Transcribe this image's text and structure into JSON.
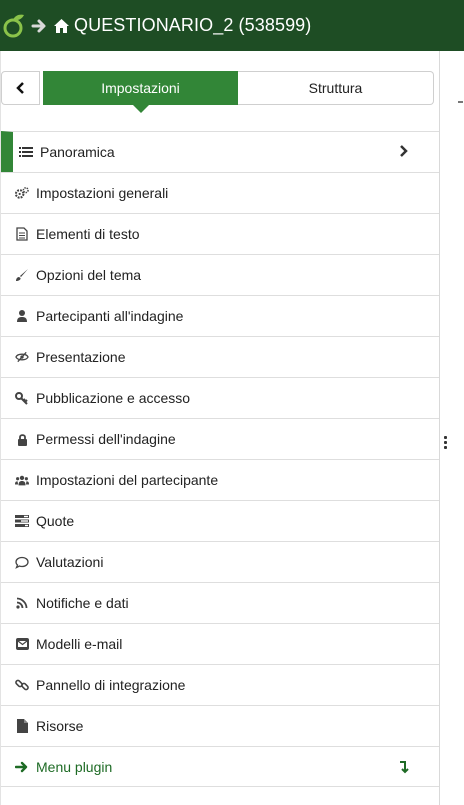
{
  "header": {
    "survey_title": "QUESTIONARIO_2 (538599)"
  },
  "tabs": {
    "settings_label": "Impostazioni",
    "structure_label": "Struttura"
  },
  "menu": {
    "items": [
      {
        "label": "Panoramica",
        "icon": "list-icon"
      },
      {
        "label": "Impostazioni generali",
        "icon": "cogs-icon"
      },
      {
        "label": "Elementi di testo",
        "icon": "document-icon"
      },
      {
        "label": "Opzioni del tema",
        "icon": "paintbrush-icon"
      },
      {
        "label": "Partecipanti all'indagine",
        "icon": "user-icon"
      },
      {
        "label": "Presentazione",
        "icon": "eye-slash-icon"
      },
      {
        "label": "Pubblicazione e accesso",
        "icon": "key-icon"
      },
      {
        "label": "Permessi dell'indagine",
        "icon": "lock-icon"
      },
      {
        "label": "Impostazioni del partecipante",
        "icon": "users-icon"
      },
      {
        "label": "Quote",
        "icon": "tasks-icon"
      },
      {
        "label": "Valutazioni",
        "icon": "comment-icon"
      },
      {
        "label": "Notifiche e dati",
        "icon": "rss-icon"
      },
      {
        "label": "Modelli e-mail",
        "icon": "envelope-icon"
      },
      {
        "label": "Pannello di integrazione",
        "icon": "link-icon"
      },
      {
        "label": "Risorse",
        "icon": "file-icon"
      },
      {
        "label": "Menu plugin",
        "icon": "arrow-right-icon"
      }
    ]
  },
  "colors": {
    "header_bg": "#1e4d24",
    "accent": "#328637"
  }
}
